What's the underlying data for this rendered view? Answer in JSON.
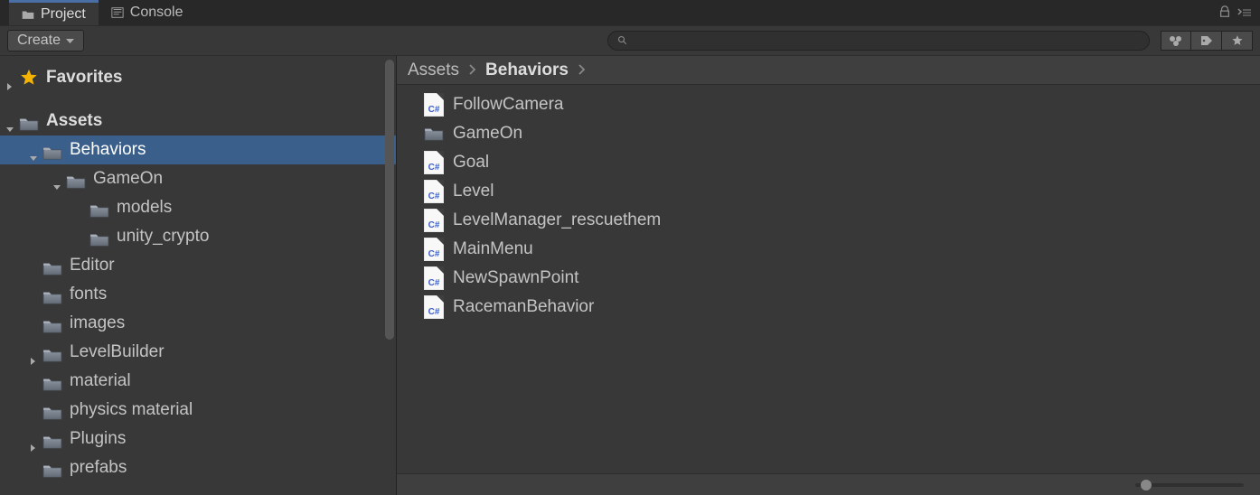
{
  "tabs": [
    {
      "label": "Project",
      "active": true,
      "icon": "folder"
    },
    {
      "label": "Console",
      "active": false,
      "icon": "console"
    }
  ],
  "toolbar": {
    "create_label": "Create",
    "search_placeholder": ""
  },
  "tree": {
    "favorites_label": "Favorites",
    "nodes": [
      {
        "label": "Assets",
        "depth": 0,
        "expanded": true,
        "chevron": true,
        "bold": true
      },
      {
        "label": "Behaviors",
        "depth": 1,
        "expanded": true,
        "chevron": true,
        "selected": true
      },
      {
        "label": "GameOn",
        "depth": 2,
        "expanded": true,
        "chevron": true
      },
      {
        "label": "models",
        "depth": 3,
        "chevron": false
      },
      {
        "label": "unity_crypto",
        "depth": 3,
        "chevron": false
      },
      {
        "label": "Editor",
        "depth": 1,
        "chevron": false
      },
      {
        "label": "fonts",
        "depth": 1,
        "chevron": false
      },
      {
        "label": "images",
        "depth": 1,
        "chevron": false
      },
      {
        "label": "LevelBuilder",
        "depth": 1,
        "chevron": true,
        "expanded": false
      },
      {
        "label": "material",
        "depth": 1,
        "chevron": false
      },
      {
        "label": "physics material",
        "depth": 1,
        "chevron": false
      },
      {
        "label": "Plugins",
        "depth": 1,
        "chevron": true,
        "expanded": false
      },
      {
        "label": "prefabs",
        "depth": 1,
        "chevron": false
      }
    ]
  },
  "breadcrumb": [
    {
      "label": "Assets",
      "bold": false
    },
    {
      "label": "Behaviors",
      "bold": true
    }
  ],
  "files": [
    {
      "label": "FollowCamera",
      "kind": "cs"
    },
    {
      "label": "GameOn",
      "kind": "folder"
    },
    {
      "label": "Goal",
      "kind": "cs"
    },
    {
      "label": "Level",
      "kind": "cs"
    },
    {
      "label": "LevelManager_rescuethem",
      "kind": "cs"
    },
    {
      "label": "MainMenu",
      "kind": "cs"
    },
    {
      "label": "NewSpawnPoint",
      "kind": "cs"
    },
    {
      "label": "RacemanBehavior",
      "kind": "cs"
    }
  ]
}
